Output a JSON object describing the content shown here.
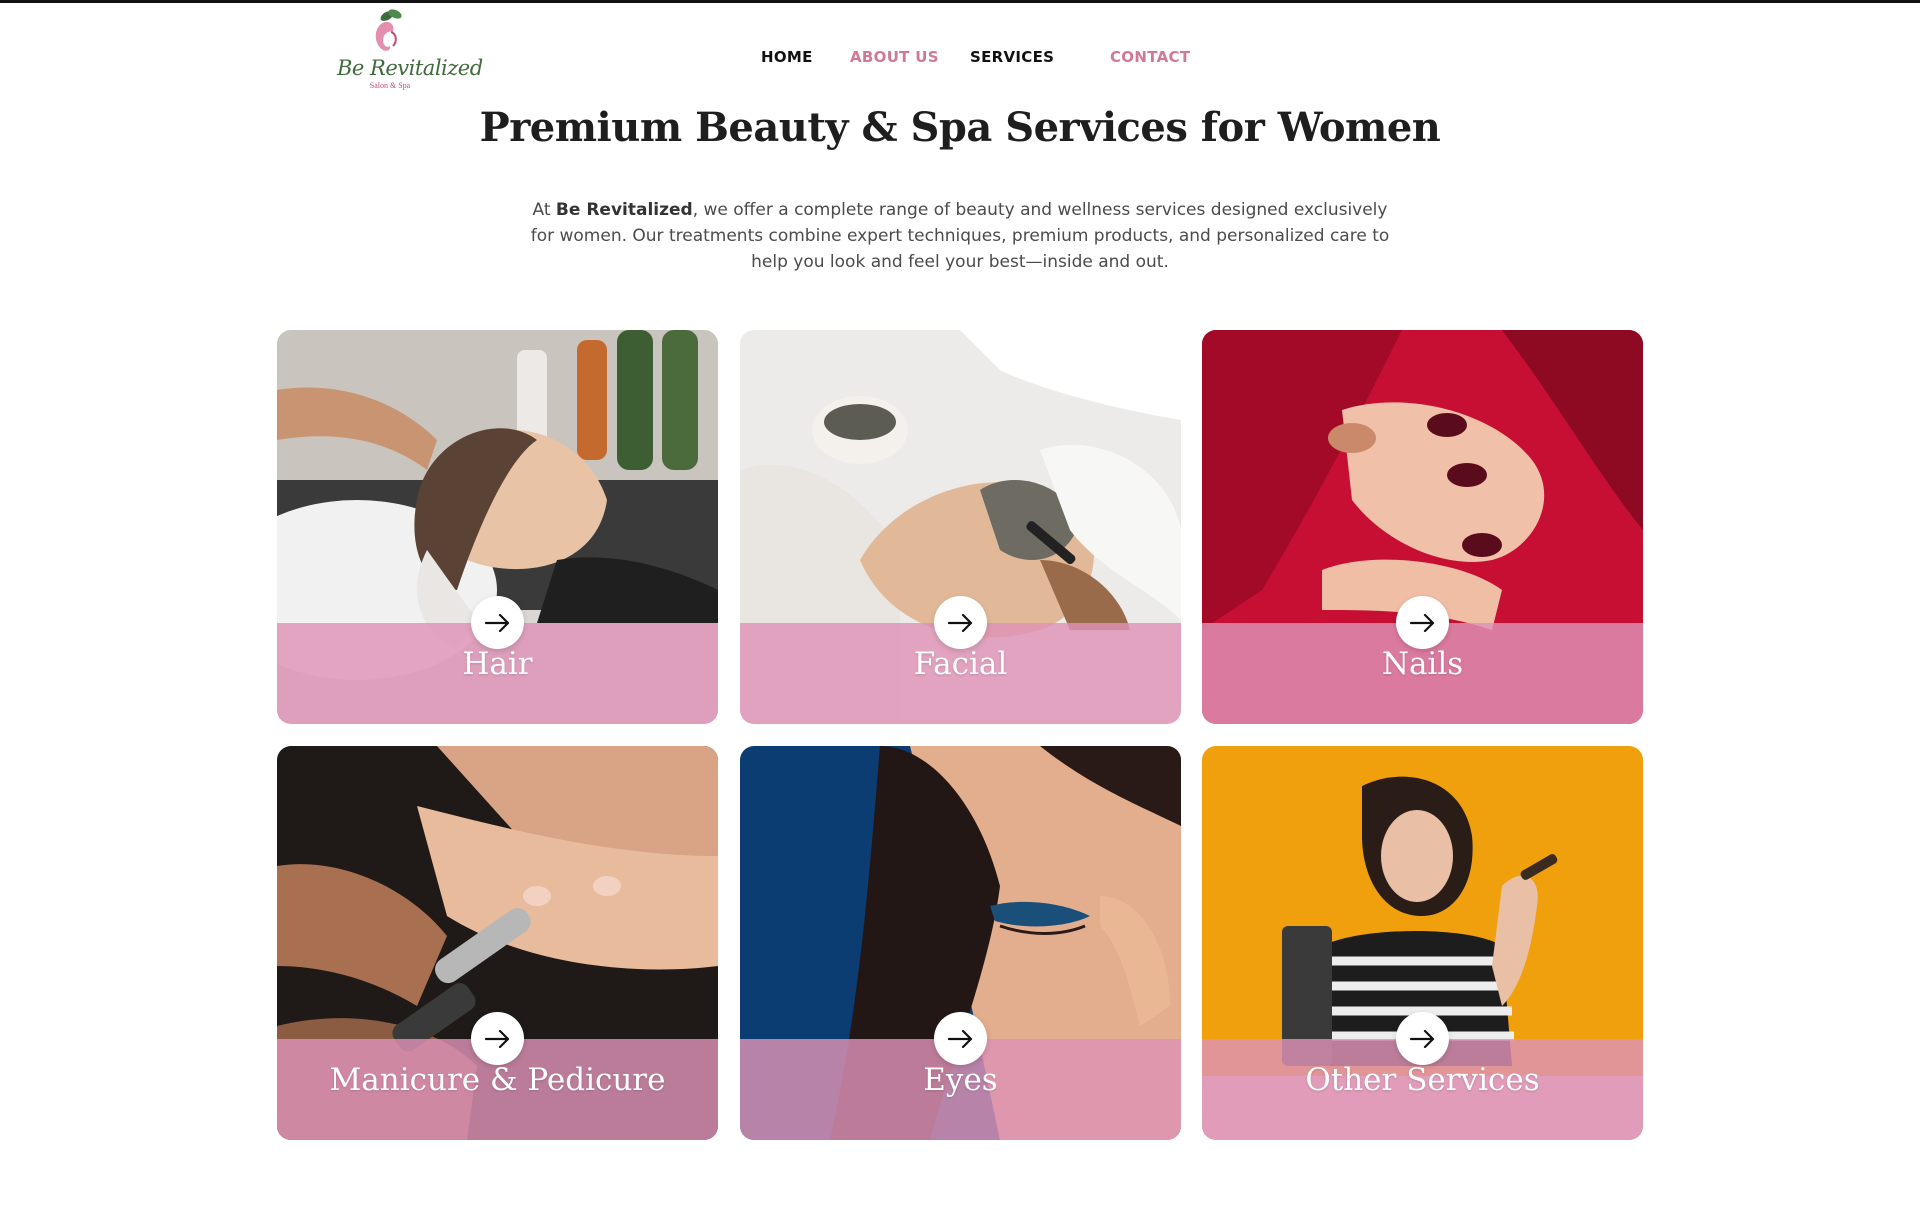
{
  "brand": {
    "name": "Be Revitalized",
    "tagline": "Salon & Spa",
    "logo_colors": [
      "#e58fb0",
      "#3f6b3c"
    ]
  },
  "nav": {
    "items": [
      {
        "label": "HOME",
        "color": "#111111"
      },
      {
        "label": "ABOUT US",
        "color": "#d07894"
      },
      {
        "label": "SERVICES",
        "color": "#111111"
      },
      {
        "label": "CONTACT",
        "color": "#d07894"
      }
    ]
  },
  "hero": {
    "title": "Premium Beauty & Spa Services for Women",
    "intro_prefix": "At ",
    "intro_brand": "Be Revitalized",
    "intro_rest": ", we offer a complete range of beauty and wellness services designed exclusively for women. Our treatments combine expert techniques, premium products, and personalized care to help you look and feel your best—inside and out."
  },
  "services": [
    {
      "label": "Hair",
      "icon": "arrow-right-icon"
    },
    {
      "label": "Facial",
      "icon": "arrow-right-icon"
    },
    {
      "label": "Nails",
      "icon": "arrow-right-icon"
    },
    {
      "label": "Manicure & Pedicure",
      "icon": "arrow-right-icon"
    },
    {
      "label": "Eyes",
      "icon": "arrow-right-icon"
    },
    {
      "label": "Other Services",
      "icon": "arrow-right-icon"
    }
  ],
  "colors": {
    "accent_pink": "#d07894",
    "overlay_pink": "#de92b6",
    "title": "#1e1e1e"
  }
}
